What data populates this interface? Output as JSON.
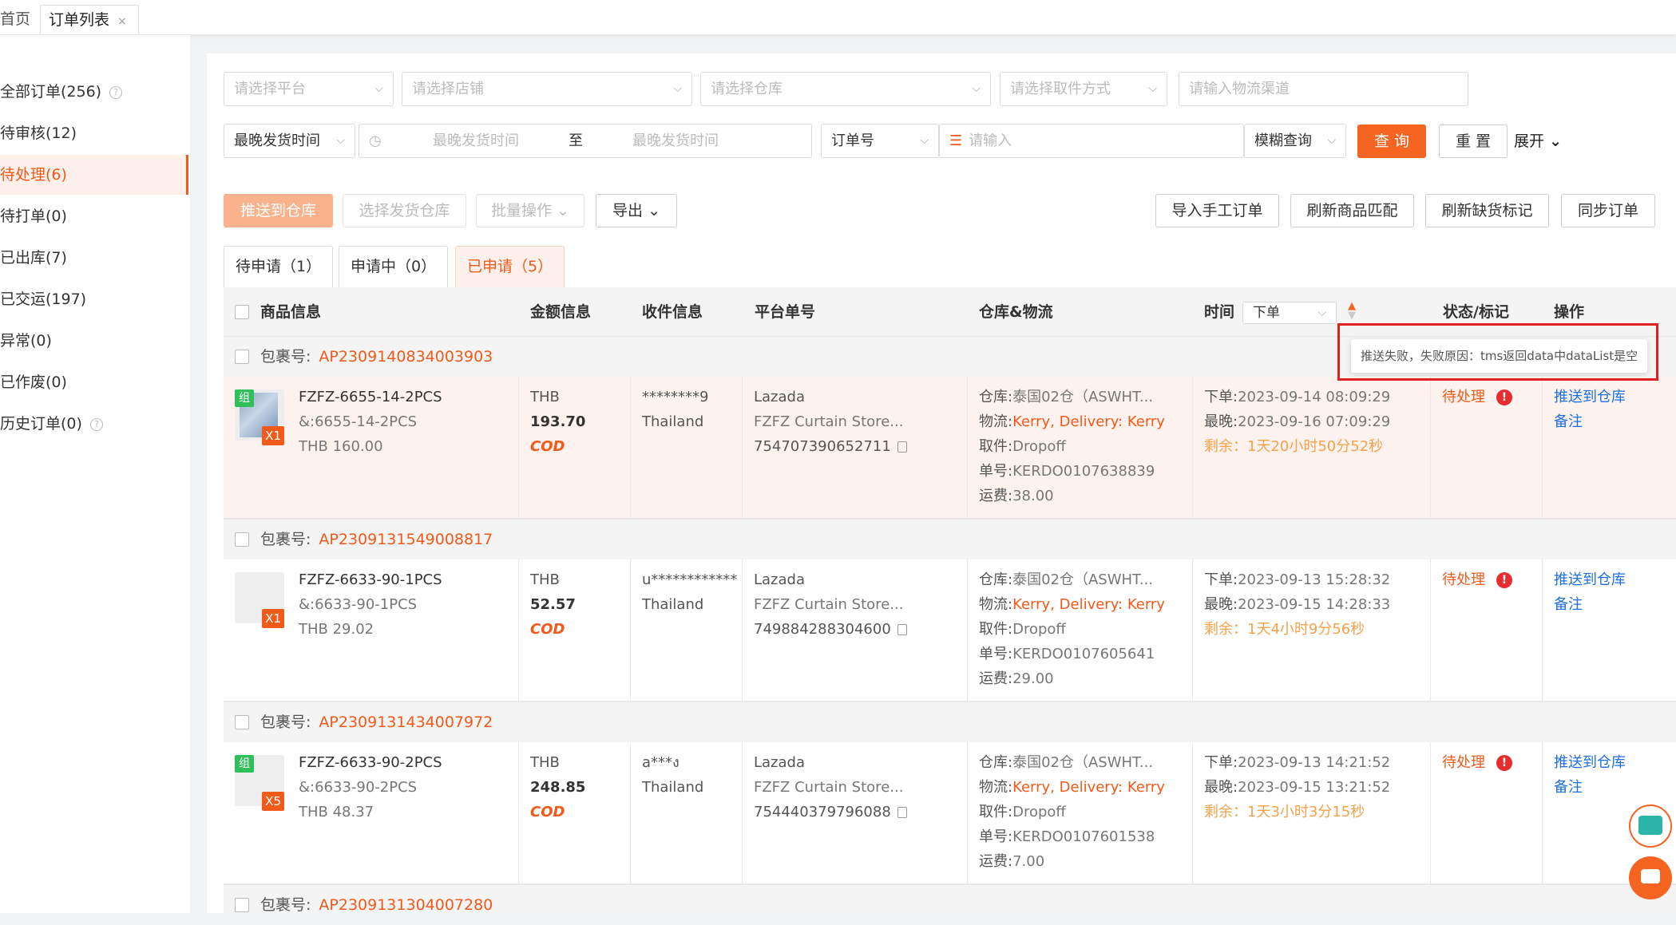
{
  "tabs": [
    {
      "label": "首页"
    },
    {
      "label": "订单列表",
      "close": "×"
    }
  ],
  "sidebar": [
    {
      "label": "全部订单(256)",
      "help": "?"
    },
    {
      "label": "待审核(12)"
    },
    {
      "label": "待处理(6)",
      "active": true
    },
    {
      "label": "待打单(0)"
    },
    {
      "label": "已出库(7)"
    },
    {
      "label": "已交运(197)"
    },
    {
      "label": "异常(0)"
    },
    {
      "label": "已作废(0)"
    },
    {
      "label": "历史订单(0)",
      "help": "?"
    }
  ],
  "filters": {
    "platform": "请选择平台",
    "shop": "请选择店铺",
    "warehouse": "请选择仓库",
    "pickup": "请选择取件方式",
    "channel": "请输入物流渠道",
    "time_type": "最晚发货时间",
    "date_start": "最晚发货时间",
    "date_sep": "至",
    "date_end": "最晚发货时间",
    "order_field": "订单号",
    "keyword_placeholder": "请输入",
    "match": "模糊查询",
    "search": "查 询",
    "reset": "重 置",
    "expand": "展开"
  },
  "actions": {
    "push": "推送到仓库",
    "choose_wh": "选择发货仓库",
    "batch": "批量操作",
    "export": "导出",
    "import_manual": "导入手工订单",
    "refresh_match": "刷新商品匹配",
    "refresh_stock": "刷新缺货标记",
    "sync": "同步订单"
  },
  "subtabs": [
    {
      "label": "待申请（1）"
    },
    {
      "label": "申请中（0）"
    },
    {
      "label": "已申请（5）",
      "active": true
    }
  ],
  "columns": {
    "product": "商品信息",
    "amount": "金额信息",
    "receiver": "收件信息",
    "platform_no": "平台单号",
    "logistics": "仓库&物流",
    "time": "时间",
    "time_sort": "下单",
    "status": "状态/标记",
    "ops": "操作"
  },
  "tooltip": "推送失败，失败原因：tms返回data中dataList是空",
  "pkg_label": "包裹号:",
  "orders": [
    {
      "pkg": "AP2309140834003903",
      "sku": "FZFZ-6655-14-2PCS",
      "sku_attr": "&:6655-14-2PCS",
      "price": "THB 160.00",
      "group_tag": "组",
      "qty": "X1",
      "currency": "THB",
      "amount": "193.70",
      "cod": "COD",
      "receiver": "********9",
      "country": "Thailand",
      "platform": "Lazada",
      "store": "FZFZ Curtain Store...",
      "platform_no": "754707390652711",
      "wh_k": "仓库:",
      "wh_v": "泰国02仓（ASWHT...",
      "lg_k": "物流:",
      "lg_v": "Kerry, Delivery: Kerry",
      "pk_k": "取件:",
      "pk_v": "Dropoff",
      "tn_k": "单号:",
      "tn_v": "KERDO0107638839",
      "fee_k": "运费:",
      "fee_v": "38.00",
      "t1_k": "下单:",
      "t1_v": "2023-09-14 08:09:29",
      "t2_k": "最晚:",
      "t2_v": "2023-09-16 07:09:29",
      "t3": "剩余：1天20小时50分52秒",
      "status": "待处理",
      "op1": "推送到仓库",
      "op2": "备注"
    },
    {
      "pkg": "AP2309131549008817",
      "sku": "FZFZ-6633-90-1PCS",
      "sku_attr": "&:6633-90-1PCS",
      "price": "THB 29.02",
      "qty": "X1",
      "currency": "THB",
      "amount": "52.57",
      "cod": "COD",
      "receiver": "u************",
      "country": "Thailand",
      "platform": "Lazada",
      "store": "FZFZ Curtain Store...",
      "platform_no": "749884288304600",
      "wh_k": "仓库:",
      "wh_v": "泰国02仓（ASWHT...",
      "lg_k": "物流:",
      "lg_v": "Kerry, Delivery: Kerry",
      "pk_k": "取件:",
      "pk_v": "Dropoff",
      "tn_k": "单号:",
      "tn_v": "KERDO0107605641",
      "fee_k": "运费:",
      "fee_v": "29.00",
      "t1_k": "下单:",
      "t1_v": "2023-09-13 15:28:32",
      "t2_k": "最晚:",
      "t2_v": "2023-09-15 14:28:33",
      "t3": "剩余：1天4小时9分56秒",
      "status": "待处理",
      "op1": "推送到仓库",
      "op2": "备注"
    },
    {
      "pkg": "AP2309131434007972",
      "sku": "FZFZ-6633-90-2PCS",
      "sku_attr": "&:6633-90-2PCS",
      "price": "THB 48.37",
      "group_tag": "组",
      "qty": "X5",
      "currency": "THB",
      "amount": "248.85",
      "cod": "COD",
      "receiver": "a***ง",
      "country": "Thailand",
      "platform": "Lazada",
      "store": "FZFZ Curtain Store...",
      "platform_no": "754440379796088",
      "wh_k": "仓库:",
      "wh_v": "泰国02仓（ASWHT...",
      "lg_k": "物流:",
      "lg_v": "Kerry, Delivery: Kerry",
      "pk_k": "取件:",
      "pk_v": "Dropoff",
      "tn_k": "单号:",
      "tn_v": "KERDO0107601538",
      "fee_k": "运费:",
      "fee_v": "7.00",
      "t1_k": "下单:",
      "t1_v": "2023-09-13 14:21:52",
      "t2_k": "最晚:",
      "t2_v": "2023-09-15 13:21:52",
      "t3": "剩余：1天3小时3分15秒",
      "status": "待处理",
      "op1": "推送到仓库",
      "op2": "备注"
    }
  ],
  "next_pkg": "AP2309131304007280",
  "colors": {
    "accent": "#f56420",
    "link": "#1e6fe0",
    "warn": "#e62e2e"
  }
}
